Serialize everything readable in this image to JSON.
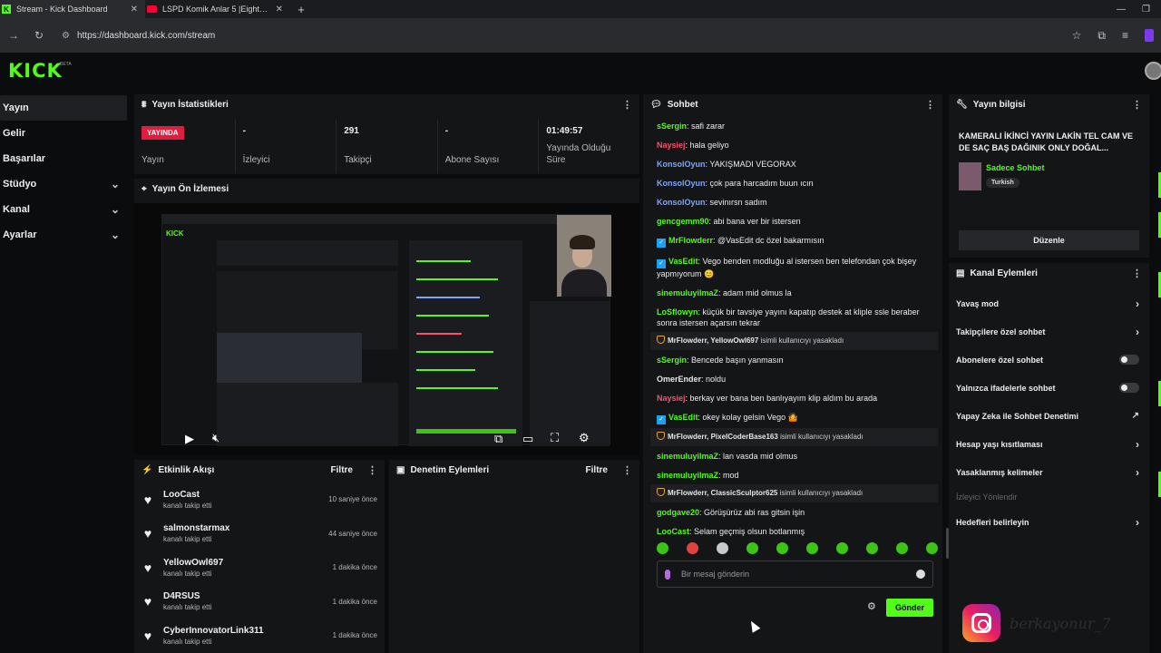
{
  "browser": {
    "tabs": [
      {
        "title": "Stream - Kick Dashboard",
        "icon": "kick-favicon"
      },
      {
        "title": "LSPD Komik Anlar 5 |Eightborn",
        "icon": "youtube-favicon"
      }
    ],
    "url": "https://dashboard.kick.com/stream"
  },
  "header": {
    "logo": "KICK",
    "beta": "BETA"
  },
  "sidebar": {
    "items": [
      {
        "label": "Yayın"
      },
      {
        "label": "Gelir"
      },
      {
        "label": "Başarılar"
      },
      {
        "label": "Stüdyo"
      },
      {
        "label": "Kanal"
      },
      {
        "label": "Ayarlar"
      }
    ]
  },
  "stats": {
    "title": "Yayın İstatistikleri",
    "live_badge": "YAYINDA",
    "stream_label": "Yayın",
    "viewers_value": "-",
    "viewers_label": "İzleyici",
    "followers_value": "291",
    "followers_label": "Takipçi",
    "subs_value": "-",
    "subs_label": "Abone Sayısı",
    "uptime_value": "01:49:57",
    "uptime_label": "Yayında Olduğu Süre"
  },
  "preview": {
    "title": "Yayın Ön İzlemesi"
  },
  "events": {
    "title": "Etkinlik Akışı",
    "filter": "Filtre",
    "items": [
      {
        "name": "LooCast",
        "action": "kanalı takip etti",
        "time": "10 saniye önce"
      },
      {
        "name": "salmonstarmax",
        "action": "kanalı takip etti",
        "time": "44 saniye önce"
      },
      {
        "name": "YellowOwl697",
        "action": "kanalı takip etti",
        "time": "1 dakika önce"
      },
      {
        "name": "D4RSUS",
        "action": "kanalı takip etti",
        "time": "1 dakika önce"
      },
      {
        "name": "CyberInnovatorLink311",
        "action": "kanalı takip etti",
        "time": "1 dakika önce"
      }
    ]
  },
  "moderation": {
    "title": "Denetim Eylemleri",
    "filter": "Filtre"
  },
  "chat": {
    "title": "Sohbet",
    "messages": [
      {
        "user": "sSergin",
        "color": "#53fc18",
        "text": "safi zarar"
      },
      {
        "user": "Naysiej",
        "color": "#ff4d6d",
        "text": "hala geliyo"
      },
      {
        "user": "KonsolOyun",
        "color": "#7aa7ff",
        "text": "YAKIŞMADI VEGORAX"
      },
      {
        "user": "KonsolOyun",
        "color": "#7aa7ff",
        "text": "çok para harcadım buun ıcın"
      },
      {
        "user": "KonsolOyun",
        "color": "#7aa7ff",
        "text": "sevinırsn sadım"
      },
      {
        "user": "gencgemm90",
        "color": "#53fc18",
        "text": "abi bana ver bir istersen"
      },
      {
        "user": "MrFlowderr",
        "color": "#53fc18",
        "text": "@VasEdit dc özel bakarmısın",
        "badge": "verified"
      },
      {
        "user": "VasEdit",
        "color": "#53fc18",
        "text": "Vego benden modluğu al istersen ben telefondan çok bişey yapmıyorum 😊",
        "badge": "verified"
      },
      {
        "user": "sinemuluyilmaZ",
        "color": "#53fc18",
        "text": "adam mid olmus la"
      },
      {
        "user": "LoSflowyn",
        "color": "#53fc18",
        "text": "küçük bir tavsiye yayını kapatıp destek at kliple ssle beraber sonra istersen açarsın tekrar"
      },
      {
        "user": "MrFlowderr, YellowOwl697",
        "system": true,
        "text": "isimli kullanıcıyı yasakladı"
      },
      {
        "user": "sSergin",
        "color": "#53fc18",
        "text": "Bencede başın yanmasın"
      },
      {
        "user": "OmerEnder",
        "color": "#e8e8e8",
        "text": "noldu"
      },
      {
        "user": "Naysiej",
        "color": "#ff4d6d",
        "text": "berkay ver bana ben banlıyayım klip aldım bu arada"
      },
      {
        "user": "VasEdit",
        "color": "#53fc18",
        "text": "okey kolay gelsin Vego 🤷",
        "badge": "verified"
      },
      {
        "user": "MrFlowderr, PixelCoderBase163",
        "system": true,
        "text": "isimli kullanıcıyı yasakladı"
      },
      {
        "user": "sinemuluyilmaZ",
        "color": "#53fc18",
        "text": "lan vasda mid olmus"
      },
      {
        "user": "sinemuluyilmaZ",
        "color": "#53fc18",
        "text": "mod"
      },
      {
        "user": "MrFlowderr, ClassicSculptor625",
        "system": true,
        "text": "isimli kullanıcıyı yasakladı"
      },
      {
        "user": "godgave20",
        "color": "#53fc18",
        "text": "Görüşürüz abi ras gitsin işin"
      },
      {
        "user": "LooCast",
        "color": "#53fc18",
        "text": "Selam geçmiş olsun botlanmış"
      }
    ],
    "input_placeholder": "Bir mesaj gönderin",
    "send_label": "Gönder"
  },
  "stream_info": {
    "title": "Yayın bilgisi",
    "stream_title": "KAMERALI İKİNCİ YAYIN LAKİN TEL CAM VE DE SAÇ BAŞ DAĞINIK ONLY DOĞAL...",
    "category": "Sadece Sohbet",
    "language": "Turkish",
    "edit_label": "Düzenle"
  },
  "channel_actions": {
    "title": "Kanal Eylemleri",
    "items": [
      {
        "label": "Yavaş mod",
        "control": "chevron"
      },
      {
        "label": "Takipçilere özel sohbet",
        "control": "chevron"
      },
      {
        "label": "Abonelere özel sohbet",
        "control": "toggle"
      },
      {
        "label": "Yalnızca ifadelerle sohbet",
        "control": "toggle"
      },
      {
        "label": "Yapay Zeka ile Sohbet Denetimi",
        "control": "external"
      },
      {
        "label": "Hesap yaşı kısıtlaması",
        "control": "chevron"
      },
      {
        "label": "Yasaklanmış kelimeler",
        "control": "chevron"
      },
      {
        "label": "İzleyici Yönlendir",
        "control": "none",
        "disabled": true
      },
      {
        "label": "Hedefleri belirleyin",
        "control": "chevron"
      }
    ]
  },
  "overlay": {
    "instagram_handle": "berkayonur_7"
  },
  "colors": {
    "accent": "#53fc18",
    "live": "#e11d3f",
    "panel": "#141517",
    "background": "#0b0c0e"
  }
}
